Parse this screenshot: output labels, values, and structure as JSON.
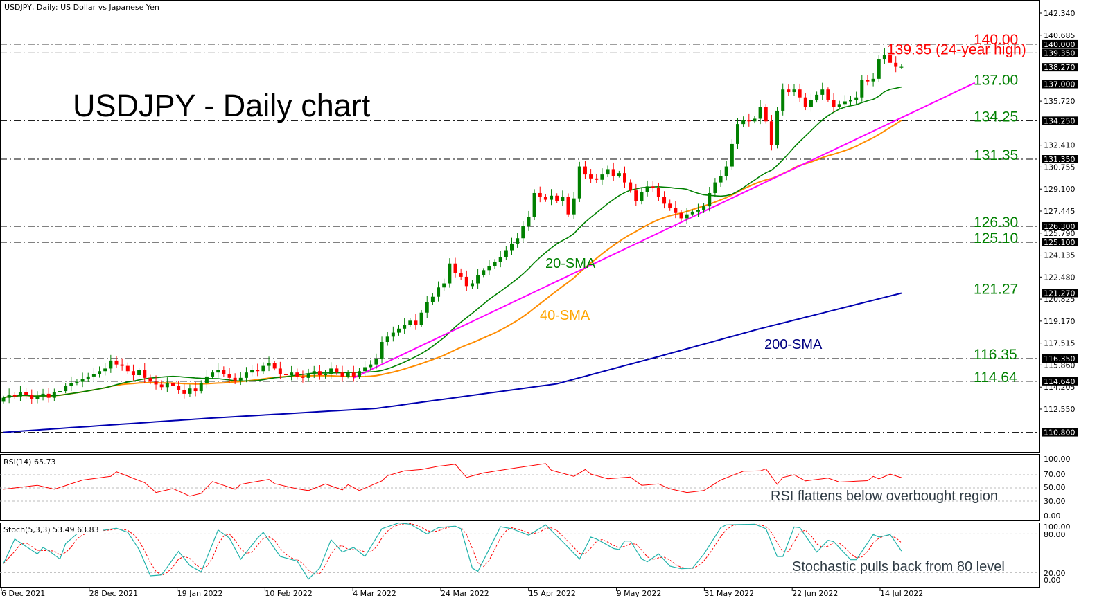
{
  "header": {
    "title": "USDJPY, Daily:  US Dollar vs Japanese Yen"
  },
  "annotations": {
    "chart_title": "USDJPY - Daily chart",
    "sma20": "20-SMA",
    "sma40": "40-SMA",
    "sma200": "200-SMA",
    "rsi_note": "RSI flattens below overbought region",
    "stoch_note": "Stochastic pulls back from 80 level"
  },
  "colors": {
    "bull": "#008000",
    "bear": "#ff0000",
    "sma20": "#008000",
    "sma40": "#ff8c00",
    "sma200": "#0000b0",
    "trendline": "#ff00ff",
    "support_label": "#008000",
    "resistance_label": "#ff0000",
    "rsi": "#ff0000",
    "stoch_main": "#20b2aa",
    "stoch_signal": "#ff0000"
  },
  "chart_data": {
    "type": "candlestick",
    "symbol": "USDJPY",
    "timeframe": "Daily",
    "ylim": [
      109.9,
      143.3
    ],
    "x_tick_labels": [
      "6 Dec 2021",
      "28 Dec 2021",
      "19 Jan 2022",
      "10 Feb 2022",
      "4 Mar 2022",
      "24 Mar 2022",
      "15 Apr 2022",
      "9 May 2022",
      "31 May 2022",
      "22 Jun 2022",
      "14 Jul 2022"
    ],
    "y_tick_labels": [
      "142.340",
      "140.685",
      "135.720",
      "132.410",
      "130.755",
      "129.100",
      "127.445",
      "125.790",
      "124.135",
      "122.480",
      "120.825",
      "119.170",
      "117.515",
      "115.860",
      "114.205",
      "112.550"
    ],
    "first_open": 113.1,
    "closes": [
      113.4,
      113.6,
      113.5,
      113.8,
      113.6,
      113.3,
      113.5,
      113.7,
      113.4,
      113.8,
      113.9,
      114.3,
      114.5,
      114.6,
      114.8,
      115.0,
      115.2,
      115.4,
      115.6,
      116.2,
      115.9,
      115.8,
      115.4,
      115.1,
      115.5,
      114.9,
      114.6,
      114.4,
      114.2,
      114.5,
      114.3,
      114.0,
      113.7,
      114.1,
      113.9,
      114.5,
      115.0,
      115.3,
      115.5,
      115.2,
      114.9,
      114.7,
      114.9,
      115.3,
      115.5,
      115.4,
      115.8,
      116.0,
      115.6,
      115.2,
      115.1,
      115.3,
      115.0,
      114.9,
      115.2,
      115.4,
      115.1,
      115.2,
      115.6,
      115.3,
      115.0,
      115.3,
      115.0,
      115.4,
      115.7,
      115.9,
      116.3,
      117.6,
      118.0,
      118.3,
      118.6,
      118.9,
      119.2,
      118.9,
      119.8,
      120.6,
      121.0,
      121.7,
      122.0,
      123.5,
      122.8,
      122.5,
      121.8,
      122.0,
      122.6,
      123.0,
      123.3,
      123.6,
      124.0,
      124.5,
      125.0,
      125.4,
      126.3,
      127.0,
      128.8,
      128.5,
      128.3,
      128.6,
      128.2,
      128.5,
      127.2,
      128.4,
      130.8,
      130.2,
      129.9,
      129.8,
      130.2,
      130.6,
      130.1,
      130.3,
      129.6,
      129.0,
      128.2,
      128.9,
      129.3,
      129.2,
      128.5,
      128.0,
      127.7,
      127.3,
      126.9,
      127.2,
      127.4,
      127.5,
      127.8,
      128.8,
      129.6,
      130.1,
      130.8,
      132.5,
      134.0,
      134.3,
      134.2,
      134.4,
      135.3,
      134.2,
      132.4,
      135.0,
      136.6,
      136.4,
      136.6,
      136.0,
      135.3,
      135.8,
      136.2,
      136.6,
      135.8,
      135.3,
      135.5,
      135.7,
      135.8,
      136.0,
      137.3,
      137.2,
      137.4,
      138.9,
      139.2,
      138.6,
      138.3,
      138.3
    ],
    "sma200_points": [
      [
        0,
        110.8
      ],
      [
        36,
        111.85
      ],
      [
        66,
        112.6
      ],
      [
        98,
        114.45
      ],
      [
        116,
        116.5
      ],
      [
        134,
        118.6
      ],
      [
        159,
        121.27
      ]
    ],
    "trendline_points": [
      [
        62,
        114.9
      ],
      [
        172,
        137.1
      ]
    ],
    "levels": [
      {
        "value": 140.0,
        "label": "140.00",
        "tag": "140.000",
        "kind": "resistance"
      },
      {
        "value": 139.35,
        "label": "139.35 (24-year high)",
        "tag": "139.350",
        "kind": "resistance"
      },
      {
        "value": 137.0,
        "label": "137.00",
        "tag": "137.000",
        "kind": "support"
      },
      {
        "value": 134.25,
        "label": "134.25",
        "tag": "134.250",
        "kind": "support"
      },
      {
        "value": 131.35,
        "label": "131.35",
        "tag": "131.350",
        "kind": "support"
      },
      {
        "value": 126.3,
        "label": "126.30",
        "tag": "126.300",
        "kind": "support"
      },
      {
        "value": 125.1,
        "label": "125.10",
        "tag": "125.100",
        "kind": "support"
      },
      {
        "value": 121.27,
        "label": "121.27",
        "tag": "121.270",
        "kind": "support"
      },
      {
        "value": 116.35,
        "label": "116.35",
        "tag": "116.350",
        "kind": "support"
      },
      {
        "value": 114.64,
        "label": "114.64",
        "tag": "114.640",
        "kind": "support"
      },
      {
        "value": 110.8,
        "label": "",
        "tag": "110.800",
        "kind": "support"
      }
    ],
    "last_price_tag": "138.270",
    "last_price": 138.27,
    "rsi": {
      "label": "RSI(14) 65.73",
      "levels": [
        70,
        50,
        30
      ],
      "axis_labels": [
        "100.00",
        "70.00",
        "50.00",
        "30.00",
        "0.00"
      ],
      "points": [
        [
          0,
          48
        ],
        [
          6,
          54
        ],
        [
          9,
          48
        ],
        [
          14,
          62
        ],
        [
          19,
          67.6
        ],
        [
          20,
          74.5
        ],
        [
          25,
          58
        ],
        [
          27,
          43
        ],
        [
          30,
          49
        ],
        [
          33,
          37.6
        ],
        [
          35,
          41.7
        ],
        [
          37,
          59.7
        ],
        [
          41,
          48
        ],
        [
          42,
          55.5
        ],
        [
          47,
          63
        ],
        [
          48,
          56.5
        ],
        [
          52,
          48.6
        ],
        [
          54,
          46
        ],
        [
          57,
          56
        ],
        [
          60,
          47
        ],
        [
          61,
          55
        ],
        [
          63,
          46
        ],
        [
          67,
          60.7
        ],
        [
          68,
          68.6
        ],
        [
          71,
          76
        ],
        [
          74,
          78
        ],
        [
          77,
          83
        ],
        [
          80,
          86
        ],
        [
          82,
          66
        ],
        [
          85,
          72.8
        ],
        [
          90,
          79.5
        ],
        [
          96,
          87
        ],
        [
          97,
          77
        ],
        [
          101,
          67.6
        ],
        [
          103,
          78
        ],
        [
          104,
          71
        ],
        [
          107,
          64
        ],
        [
          111,
          66.5
        ],
        [
          113,
          54
        ],
        [
          116,
          56
        ],
        [
          118,
          48.6
        ],
        [
          121,
          43
        ],
        [
          124,
          46
        ],
        [
          127,
          62
        ],
        [
          131,
          75.5
        ],
        [
          134,
          76
        ],
        [
          135,
          79
        ],
        [
          137,
          55.5
        ],
        [
          138,
          66
        ],
        [
          140,
          70
        ],
        [
          142,
          60.7
        ],
        [
          146,
          65
        ],
        [
          148,
          59
        ],
        [
          153,
          61
        ],
        [
          154,
          67.6
        ],
        [
          155,
          63.8
        ],
        [
          157,
          71
        ],
        [
          159,
          65.73
        ]
      ]
    },
    "stochastic": {
      "label": "Stoch(5,3,3) 53.49 63.83",
      "levels": [
        80,
        20
      ],
      "axis_labels": [
        "100.00",
        "80.00",
        "20.00",
        "0.00"
      ],
      "main_points": [
        [
          0,
          34
        ],
        [
          2,
          72
        ],
        [
          6,
          49
        ],
        [
          7,
          59
        ],
        [
          8,
          54
        ],
        [
          10,
          41
        ],
        [
          11,
          65
        ],
        [
          13,
          80
        ],
        [
          15,
          84
        ],
        [
          18,
          86
        ],
        [
          20,
          88.6
        ],
        [
          22,
          82.5
        ],
        [
          24,
          56
        ],
        [
          26,
          15
        ],
        [
          28,
          16.4
        ],
        [
          31,
          53
        ],
        [
          33,
          31
        ],
        [
          35,
          21
        ],
        [
          38,
          86
        ],
        [
          40,
          73.6
        ],
        [
          42,
          40.7
        ],
        [
          45,
          73.6
        ],
        [
          46,
          82.5
        ],
        [
          49,
          45
        ],
        [
          52,
          38
        ],
        [
          54,
          10
        ],
        [
          56,
          27
        ],
        [
          58,
          71
        ],
        [
          60,
          52
        ],
        [
          62,
          59
        ],
        [
          64,
          45
        ],
        [
          67,
          88
        ],
        [
          70,
          97
        ],
        [
          72,
          95
        ],
        [
          75,
          80
        ],
        [
          77,
          89.6
        ],
        [
          80,
          92
        ],
        [
          81,
          88
        ],
        [
          83,
          27
        ],
        [
          84,
          22
        ],
        [
          88,
          91
        ],
        [
          90,
          88
        ],
        [
          93,
          78
        ],
        [
          96,
          94
        ],
        [
          99,
          68
        ],
        [
          102,
          41
        ],
        [
          104,
          75
        ],
        [
          105,
          72
        ],
        [
          108,
          57.5
        ],
        [
          109,
          55.7
        ],
        [
          110,
          69
        ],
        [
          111,
          69
        ],
        [
          113,
          41
        ],
        [
          114,
          37
        ],
        [
          116,
          49
        ],
        [
          118,
          30
        ],
        [
          120,
          26
        ],
        [
          122,
          27
        ],
        [
          124,
          48.6
        ],
        [
          127,
          89.6
        ],
        [
          128,
          94
        ],
        [
          133,
          95
        ],
        [
          135,
          88
        ],
        [
          137,
          45
        ],
        [
          138,
          45
        ],
        [
          140,
          90.7
        ],
        [
          141,
          89.6
        ],
        [
          144,
          52
        ],
        [
          146,
          70
        ],
        [
          147,
          68
        ],
        [
          150,
          40
        ],
        [
          151,
          40
        ],
        [
          154,
          79
        ],
        [
          155,
          75
        ],
        [
          157,
          79
        ],
        [
          159,
          53.49
        ]
      ]
    }
  }
}
